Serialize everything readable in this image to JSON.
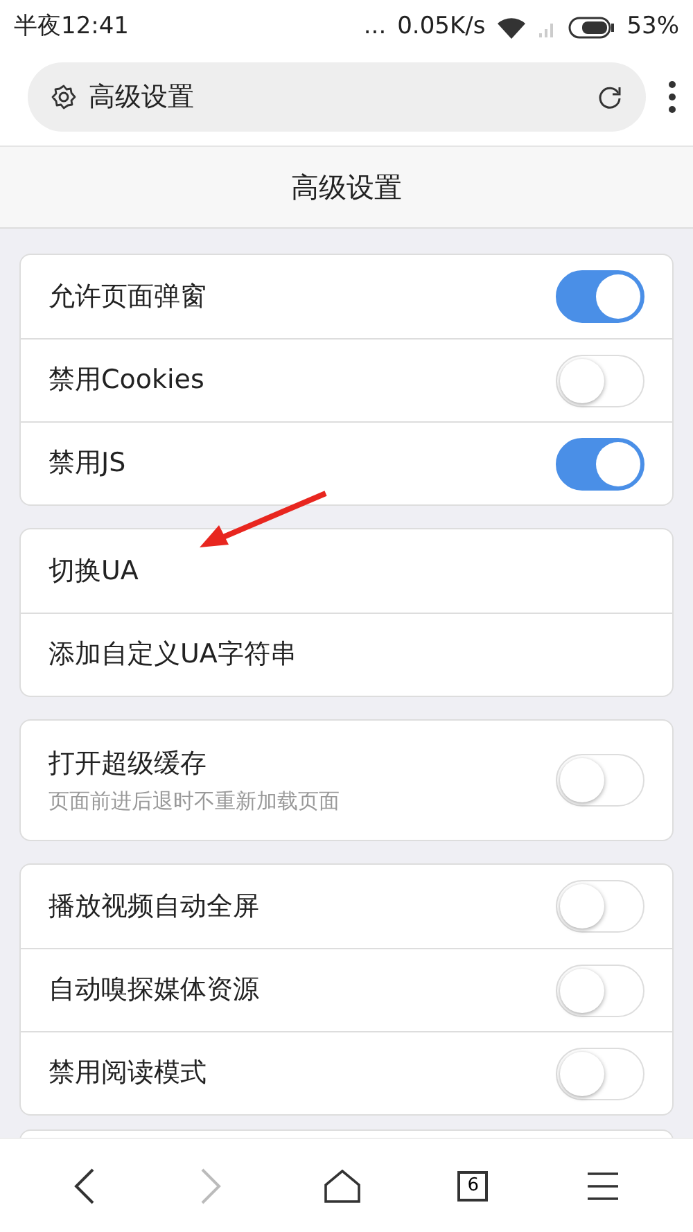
{
  "status_bar": {
    "time": "半夜12:41",
    "dots": "...",
    "speed": "0.05K/s",
    "battery": "53%"
  },
  "address_bar": {
    "title": "高级设置"
  },
  "header": {
    "title": "高级设置"
  },
  "groups": [
    {
      "rows": [
        {
          "kind": "toggle",
          "label": "允许页面弹窗",
          "on": true
        },
        {
          "kind": "toggle",
          "label": "禁用Cookies",
          "on": false
        },
        {
          "kind": "toggle",
          "label": "禁用JS",
          "on": true
        }
      ]
    },
    {
      "rows": [
        {
          "kind": "link",
          "label": "切换UA"
        },
        {
          "kind": "link",
          "label": "添加自定义UA字符串"
        }
      ]
    },
    {
      "rows": [
        {
          "kind": "toggle",
          "label": "打开超级缓存",
          "subtitle": "页面前进后退时不重新加载页面",
          "on": false
        }
      ]
    },
    {
      "rows": [
        {
          "kind": "toggle",
          "label": "播放视频自动全屏",
          "on": false
        },
        {
          "kind": "toggle",
          "label": "自动嗅探媒体资源",
          "on": false
        },
        {
          "kind": "toggle",
          "label": "禁用阅读模式",
          "on": false
        }
      ]
    }
  ],
  "bottom_nav": {
    "back_disabled": false,
    "forward_disabled": true,
    "tab_count": "6"
  }
}
